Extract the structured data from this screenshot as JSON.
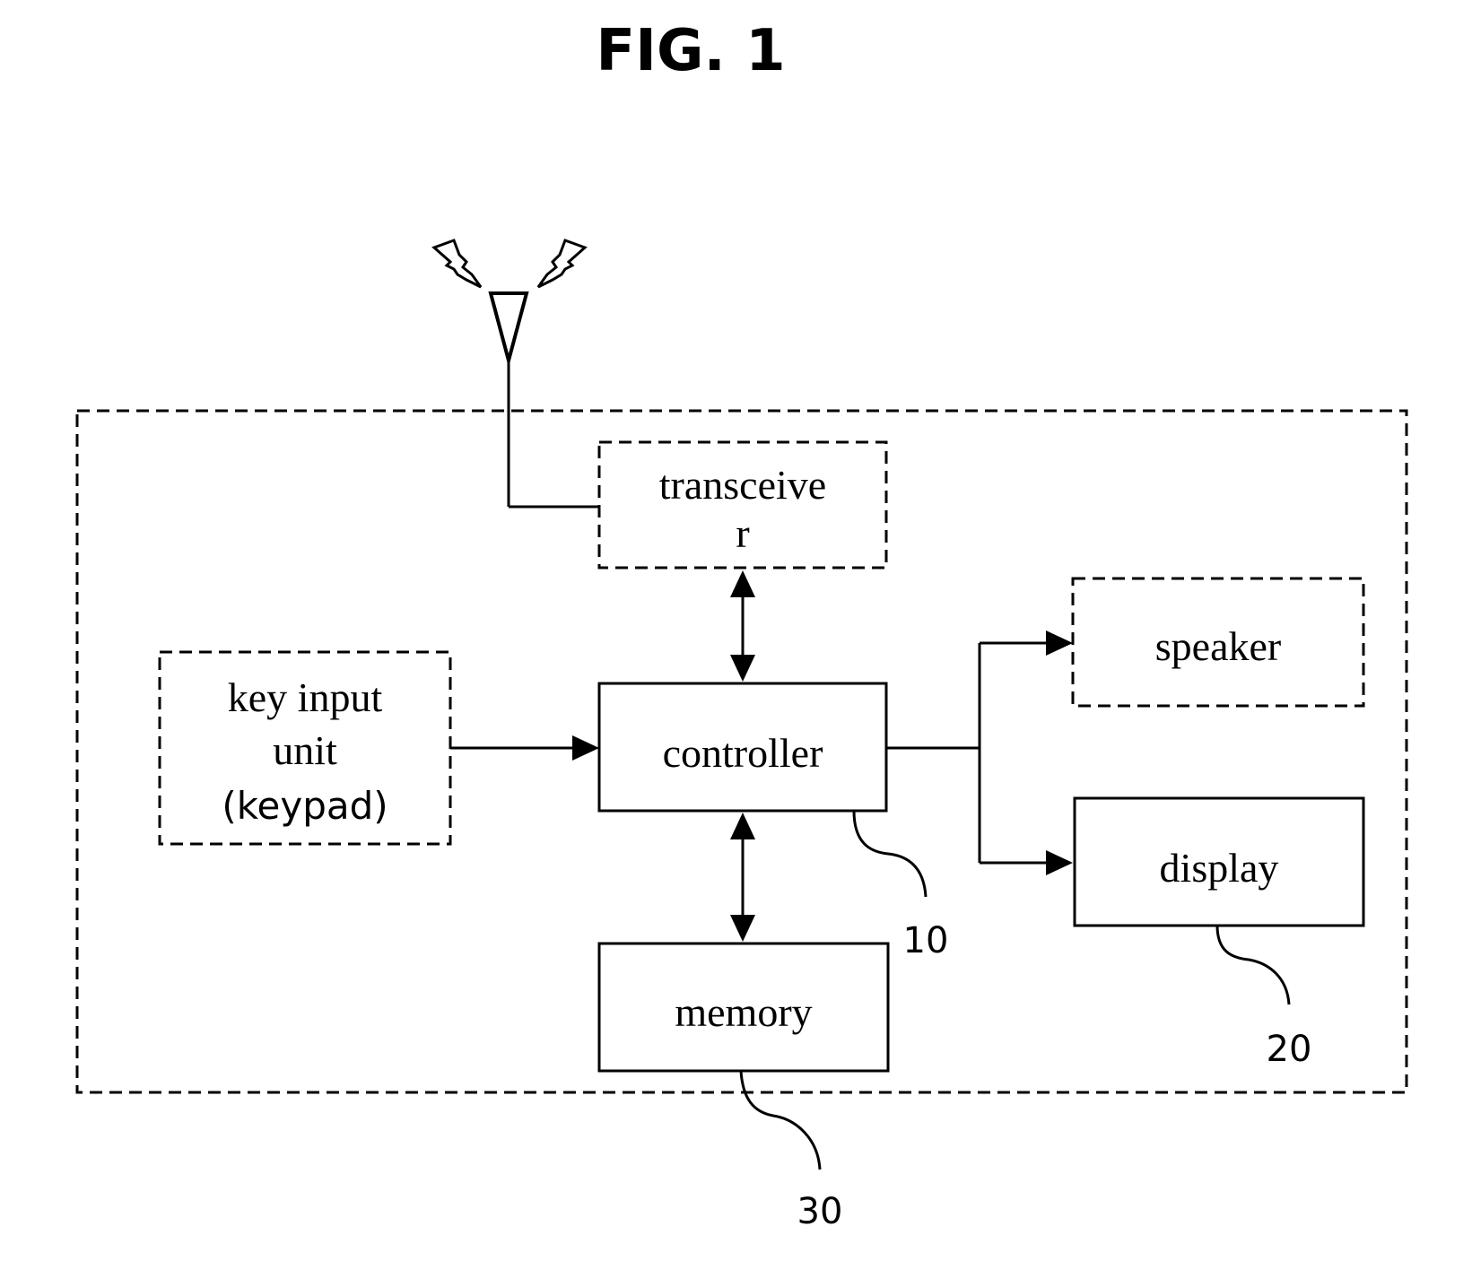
{
  "figure": {
    "title": "FIG. 1"
  },
  "blocks": {
    "transceiver": {
      "lines": [
        "transceive",
        "r"
      ],
      "border": "dashed"
    },
    "key_input": {
      "lines": [
        "key input",
        "unit",
        "(keypad)"
      ],
      "border": "dashed"
    },
    "controller": {
      "lines": [
        "controller"
      ],
      "border": "solid",
      "ref": "10"
    },
    "speaker": {
      "lines": [
        "speaker"
      ],
      "border": "dashed"
    },
    "display": {
      "lines": [
        "display"
      ],
      "border": "solid",
      "ref": "20"
    },
    "memory": {
      "lines": [
        "memory"
      ],
      "border": "solid",
      "ref": "30"
    }
  },
  "connections": [
    {
      "from": "antenna",
      "to": "transceiver",
      "type": "line"
    },
    {
      "from": "transceiver",
      "to": "controller",
      "type": "bidirectional"
    },
    {
      "from": "key_input",
      "to": "controller",
      "type": "arrow"
    },
    {
      "from": "controller",
      "to": "speaker",
      "type": "arrow"
    },
    {
      "from": "controller",
      "to": "display",
      "type": "arrow"
    },
    {
      "from": "controller",
      "to": "memory",
      "type": "bidirectional"
    }
  ],
  "colors": {
    "ink": "#000000",
    "background": "#ffffff"
  }
}
